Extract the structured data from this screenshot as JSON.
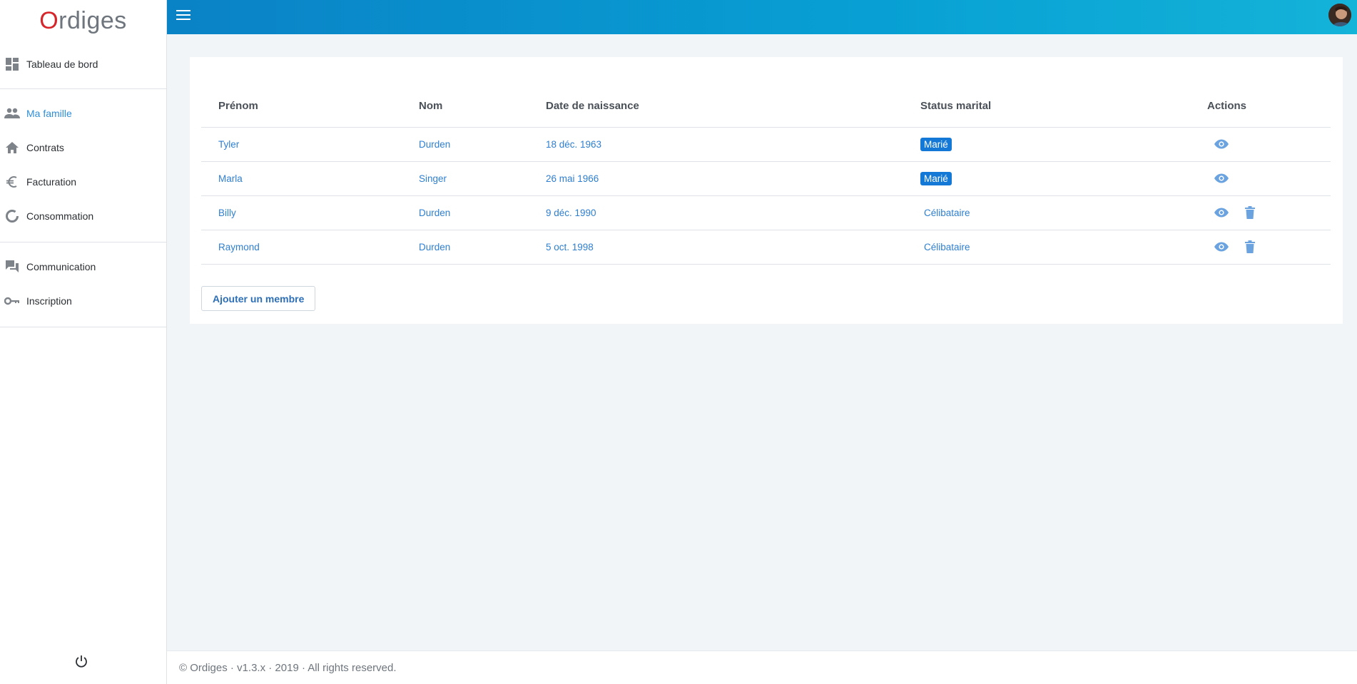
{
  "brand": {
    "logo_first": "O",
    "logo_rest": "rdiges"
  },
  "sidebar": {
    "groups": [
      {
        "items": [
          {
            "label": "Tableau de bord",
            "icon": "dashboard-icon"
          }
        ]
      },
      {
        "items": [
          {
            "label": "Ma famille",
            "icon": "people-icon",
            "active": true
          },
          {
            "label": "Contrats",
            "icon": "home-icon"
          },
          {
            "label": "Facturation",
            "icon": "euro-icon"
          },
          {
            "label": "Consommation",
            "icon": "donut-icon"
          }
        ]
      },
      {
        "items": [
          {
            "label": "Communication",
            "icon": "chat-icon"
          },
          {
            "label": "Inscription",
            "icon": "key-icon"
          }
        ]
      }
    ],
    "logout_icon": "power-icon"
  },
  "header": {
    "menu_icon": "hamburger-icon"
  },
  "table": {
    "headers": [
      "Prénom",
      "Nom",
      "Date de naissance",
      "Status marital",
      "Actions"
    ],
    "rows": [
      {
        "prenom": "Tyler",
        "nom": "Durden",
        "date": "18 déc. 1963",
        "status": "Marié",
        "badge": true,
        "deletable": false
      },
      {
        "prenom": "Marla",
        "nom": "Singer",
        "date": "26 mai 1966",
        "status": "Marié",
        "badge": true,
        "deletable": false
      },
      {
        "prenom": "Billy",
        "nom": "Durden",
        "date": "9 déc. 1990",
        "status": "Célibataire",
        "badge": false,
        "deletable": true
      },
      {
        "prenom": "Raymond",
        "nom": "Durden",
        "date": "5 oct. 1998",
        "status": "Célibataire",
        "badge": false,
        "deletable": true
      }
    ]
  },
  "add_button": {
    "label": "Ajouter un membre"
  },
  "footer": {
    "text": "© Ordiges · v1.3.x · 2019 · All rights reserved."
  },
  "colors": {
    "accent": "#1479d6",
    "link": "#2e7fd0",
    "header_start": "#0a82c6",
    "header_end": "#14b3d8",
    "logo_red": "#d7262b"
  }
}
